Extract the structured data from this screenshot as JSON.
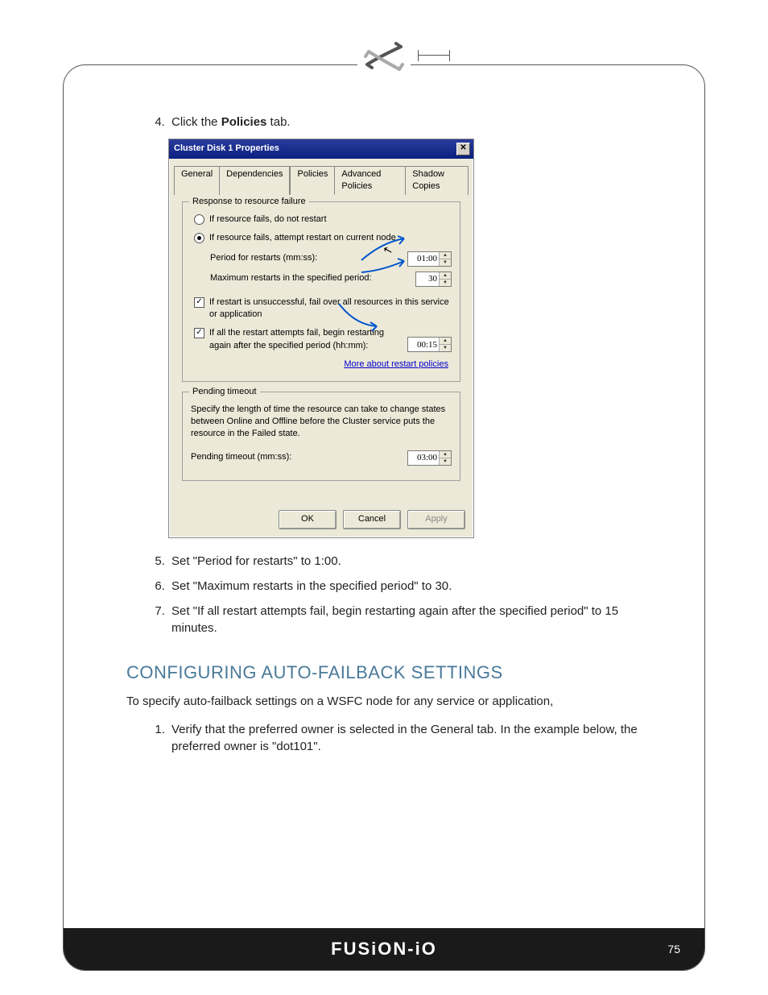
{
  "step4": {
    "number": "4.",
    "prefix": "Click the ",
    "bold": "Policies",
    "suffix": " tab."
  },
  "dialog": {
    "title": "Cluster Disk 1 Properties",
    "tabs": [
      "General",
      "Dependencies",
      "Policies",
      "Advanced Policies",
      "Shadow Copies"
    ],
    "group1": {
      "legend": "Response to resource failure",
      "radio1": "If resource fails, do not restart",
      "radio2": "If resource fails, attempt restart on current node",
      "period_label": "Period for restarts (mm:ss):",
      "period_value": "01:00",
      "max_label": "Maximum restarts in the specified period:",
      "max_value": "30",
      "check1": "If restart is unsuccessful, fail over all resources in this service or application",
      "check2": "If all the restart attempts fail, begin restarting again after the specified period (hh:mm):",
      "check2_value": "00:15",
      "link": "More about restart policies"
    },
    "group2": {
      "legend": "Pending timeout",
      "desc": "Specify the length of time the resource can take to change states between Online and Offline before the Cluster service puts the resource in the Failed state.",
      "label": "Pending timeout (mm:ss):",
      "value": "03:00"
    },
    "buttons": {
      "ok": "OK",
      "cancel": "Cancel",
      "apply": "Apply"
    }
  },
  "step5": "Set \"Period for restarts\" to 1:00.",
  "step6": "Set \"Maximum restarts in the specified period\" to 30.",
  "step7": "Set \"If all restart attempts fail, begin restarting again after the specified period\" to 15 minutes.",
  "heading": "CONFIGURING AUTO-FAILBACK SETTINGS",
  "intro": "To specify auto-failback settings on a WSFC node for any service or application,",
  "sub1": "Verify that the preferred owner is selected in the General tab. In the example below, the preferred owner is \"dot101\".",
  "footer": {
    "logo": "FUSiON-iO",
    "page": "75"
  }
}
